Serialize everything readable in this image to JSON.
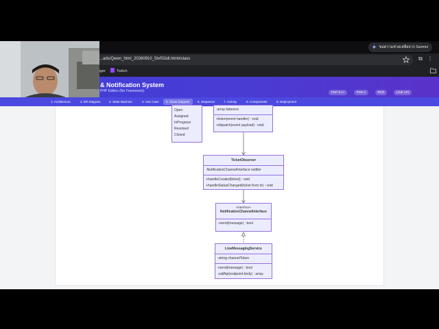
{
  "gemini": {
    "label": "ขอความช่วยเหลือจาก Gemini"
  },
  "address_bar": {
    "url": "...ads/Qwen_html_20260910_5tvf02idl.html#class"
  },
  "bookmarks": [
    {
      "label": "nger"
    },
    {
      "label": "Twitch"
    }
  ],
  "header": {
    "title": "& Notification System",
    "subtitle": "PHP Edition (No Framework)",
    "badges": [
      "PHP 8.2+",
      "PSR-4",
      "PDO",
      "LINE API"
    ]
  },
  "tabs": [
    {
      "label": "1. Architecture"
    },
    {
      "label": "2. ER Diagram"
    },
    {
      "label": "3. State Machine"
    },
    {
      "label": "4. Use Case"
    },
    {
      "label": "5. Class Diagram",
      "active": true
    },
    {
      "label": "6. Sequence"
    },
    {
      "label": "7. Activity"
    },
    {
      "label": "8. Components"
    },
    {
      "label": "9. Deployment"
    }
  ],
  "diagram": {
    "enum_box": {
      "values": [
        "Open",
        "Assigned",
        "InProgress",
        "Resolved",
        "Closed"
      ]
    },
    "dispatcher": {
      "attributes": [
        "-array listeners"
      ],
      "methods": [
        "+listen(event handler) : void",
        "+dispatch(event payload) : void"
      ]
    },
    "ticket_observer": {
      "name": "TicketObserver",
      "attributes": [
        "-NotificationChannelInterface notifier"
      ],
      "methods": [
        "+handleCreated(ticket) : void",
        "+handleStatusChanged(ticket from to) : void"
      ]
    },
    "channel_interface": {
      "stereotype": "«interface»",
      "name": "NotificationChannelInterface",
      "methods": [
        "+send(message) : bool"
      ]
    },
    "line_service": {
      "name": "LineMessagingService",
      "attributes": [
        "-string channelToken"
      ],
      "methods": [
        "+send(message) : bool",
        "-callApi(endpoint body) : array"
      ]
    }
  },
  "colors": {
    "header_start": "#3f3fd9",
    "header_end": "#5a32c9",
    "tab_bar": "#4b49e0",
    "class_fill": "#ececff",
    "class_border": "#9370db"
  }
}
